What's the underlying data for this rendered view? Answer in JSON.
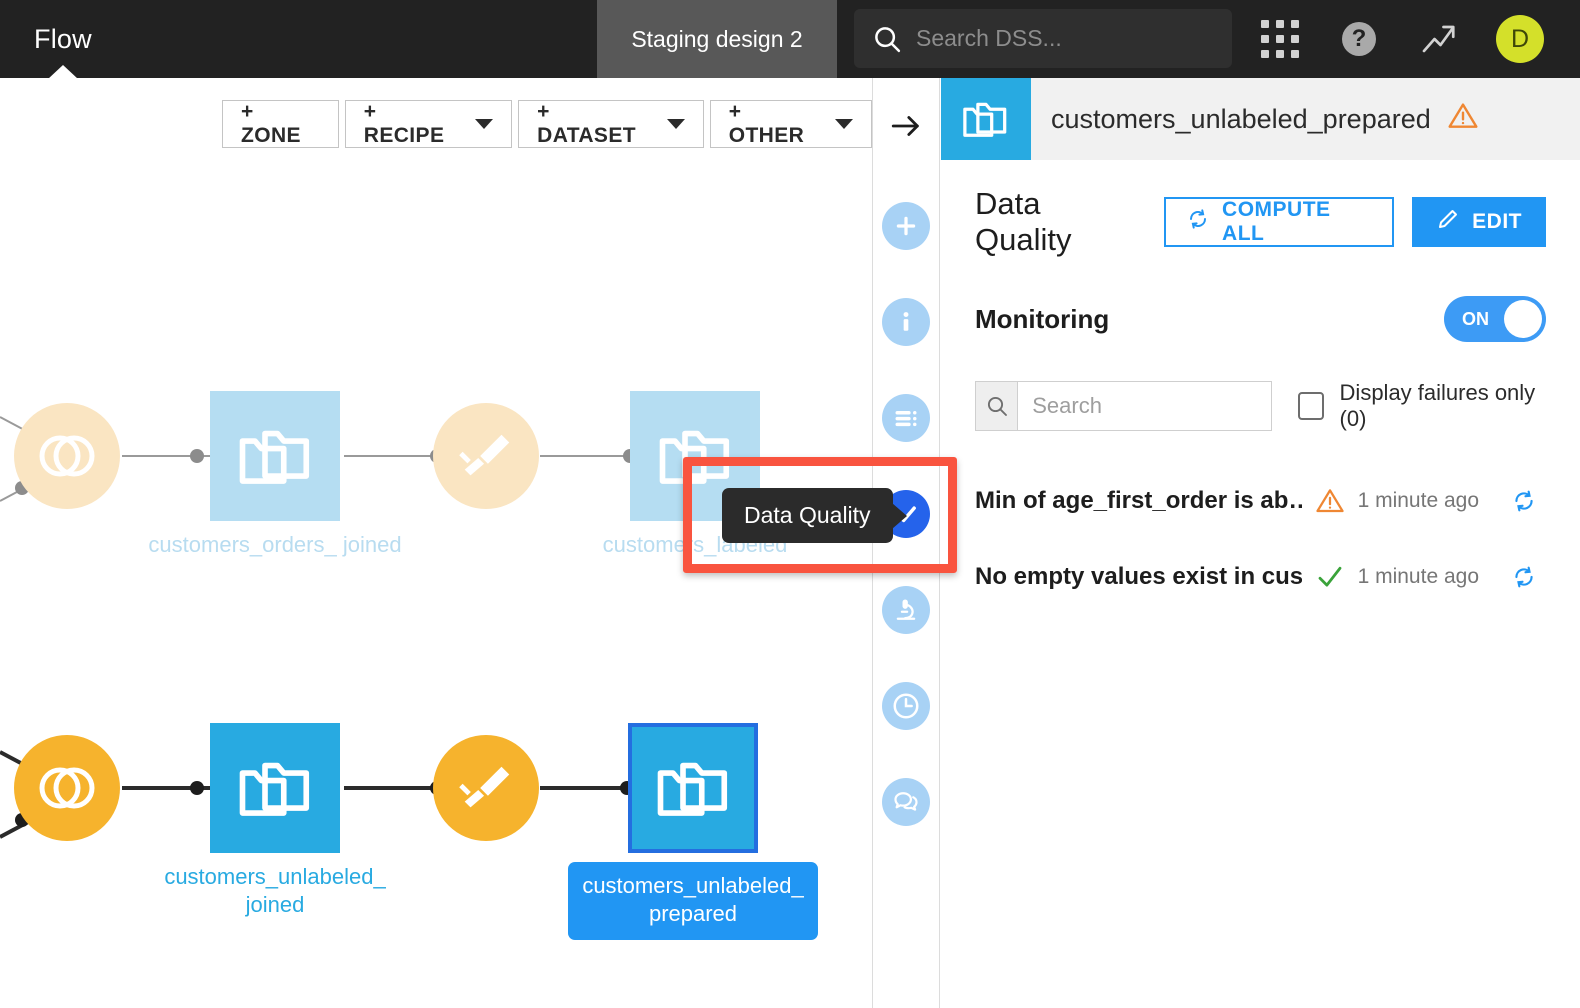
{
  "topbar": {
    "flow_tab_label": "Flow",
    "project_tab_label": "Staging design 2",
    "search_placeholder": "Search DSS...",
    "search_value": "",
    "apps_icon": "apps-grid-icon",
    "help_icon": "help-icon",
    "trend_icon": "trending-arrow-icon",
    "avatar_initial": "D",
    "avatar_color": "#d4e02a"
  },
  "flow_toolbar": {
    "buttons": [
      {
        "label": "+ ZONE",
        "has_caret": false
      },
      {
        "label": "+ RECIPE",
        "has_caret": true
      },
      {
        "label": "+ DATASET",
        "has_caret": true
      },
      {
        "label": "+ OTHER",
        "has_caret": true
      }
    ]
  },
  "flow": {
    "tooltip_label": "Data Quality",
    "highlight_color": "#f9543f",
    "nodes": [
      {
        "name": "join-recipe-top",
        "type": "recipe-join",
        "state": "dim",
        "label": ""
      },
      {
        "name": "dataset-customers-orders-joined",
        "type": "dataset",
        "state": "dim",
        "label": "customers_orders_\njoined"
      },
      {
        "name": "prepare-recipe-top",
        "type": "recipe-prepare",
        "state": "dim",
        "label": ""
      },
      {
        "name": "dataset-customers-labeled",
        "type": "dataset",
        "state": "dim",
        "label": "customers_labeled"
      },
      {
        "name": "join-recipe-bottom",
        "type": "recipe-join",
        "state": "on",
        "label": ""
      },
      {
        "name": "dataset-customers-unlabeled-joined",
        "type": "dataset",
        "state": "on",
        "label": "customers_unlabeled_\njoined"
      },
      {
        "name": "prepare-recipe-bottom",
        "type": "recipe-prepare",
        "state": "on",
        "label": ""
      },
      {
        "name": "dataset-customers-unlabeled-prepared",
        "type": "dataset",
        "state": "selected",
        "label": "customers_unlabeled_\nprepared"
      }
    ],
    "labels": {
      "customers_orders_joined": "customers_orders_\njoined",
      "customers_labeled": "customers_labeled",
      "customers_unlabeled_joined": "customers_unlabeled_\njoined",
      "customers_unlabeled_prepared": "customers_unlabeled_\nprepared"
    }
  },
  "rail": {
    "items": [
      {
        "name": "collapse-arrow-icon",
        "icon": "arrow-right-icon",
        "active": false,
        "plain": true
      },
      {
        "name": "add-icon",
        "icon": "plus-icon",
        "active": false
      },
      {
        "name": "info-icon",
        "icon": "info-icon",
        "active": false
      },
      {
        "name": "details-icon",
        "icon": "list-details-icon",
        "active": false
      },
      {
        "name": "data-quality-icon",
        "icon": "check-circle-icon",
        "active": true
      },
      {
        "name": "lab-icon",
        "icon": "microscope-icon",
        "active": false
      },
      {
        "name": "history-icon",
        "icon": "clock-icon",
        "active": false
      },
      {
        "name": "discussions-icon",
        "icon": "chat-bubbles-icon",
        "active": false
      }
    ]
  },
  "panel": {
    "header": {
      "dataset_icon": "folder-dataset-icon",
      "title": "customers_unlabeled_prepared",
      "warning_icon": "warning-triangle-icon"
    },
    "section_title": "Data Quality",
    "compute_all_label": "COMPUTE ALL",
    "compute_all_icon": "refresh-icon",
    "edit_label": "EDIT",
    "edit_icon": "pencil-icon",
    "monitoring_label": "Monitoring",
    "monitoring_state": "ON",
    "search_placeholder": "Search",
    "search_value": "",
    "search_icon": "search-icon",
    "failures_checkbox_label": "Display failures only (0)",
    "failures_checked": false,
    "rules": [
      {
        "name": "Min of age_first_order is ab…",
        "status": "warning",
        "status_icon": "warning-triangle-icon",
        "timestamp": "1 minute ago",
        "refresh_icon": "refresh-icon"
      },
      {
        "name": "No empty values exist in cus…",
        "status": "ok",
        "status_icon": "check-icon",
        "timestamp": "1 minute ago",
        "refresh_icon": "refresh-icon"
      }
    ]
  },
  "colors": {
    "dataset_blue": "#28aae1",
    "dataset_blue_dim": "#b5ddf2",
    "recipe_orange": "#f6b32d",
    "recipe_orange_dim": "#fae5c2",
    "accent_blue": "#2196f3",
    "selected_border": "#246ee0",
    "warning_orange": "#ef8733",
    "ok_green": "#3aa33a",
    "topbar_dark": "#222222"
  }
}
